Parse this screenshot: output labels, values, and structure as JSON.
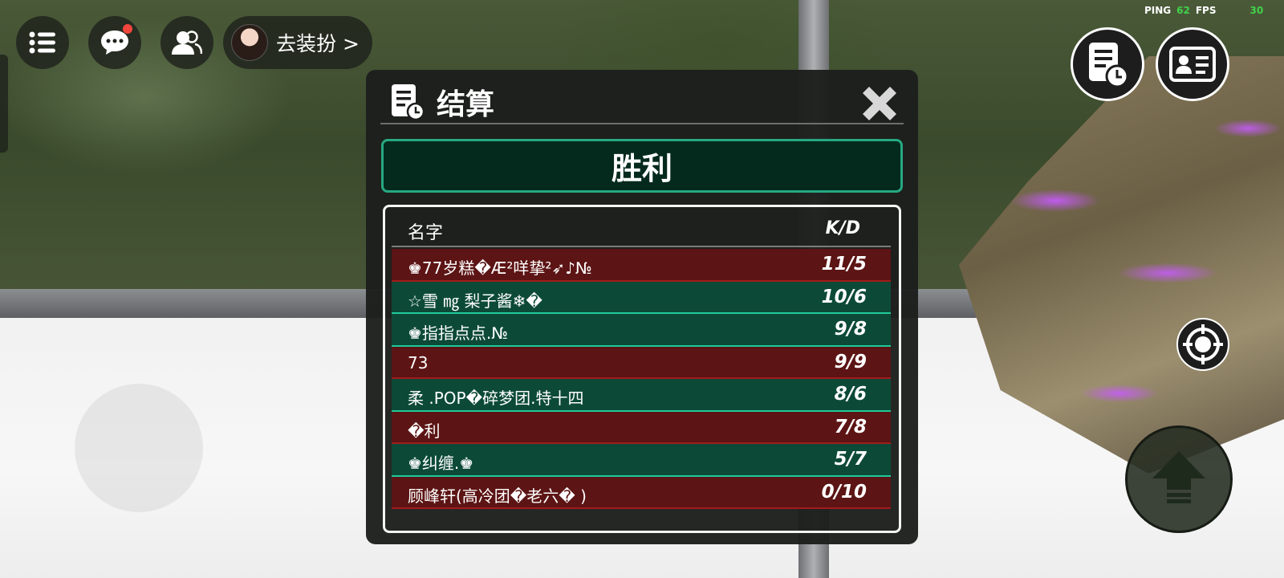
{
  "hud": {
    "dress_label": "去装扮 >",
    "ping_label": "PING",
    "ping_value": "62",
    "fps_label": "FPS",
    "fps_value": "30",
    "chat_has_notification": true
  },
  "dialog": {
    "title": "结算",
    "result": "胜利",
    "columns": {
      "name": "名字",
      "kd": "K/D"
    },
    "rows": [
      {
        "name": "♚77岁糕�Æ²咩挚²➶♪№",
        "kd": "11/5",
        "team": "red"
      },
      {
        "name": "☆雪 ㎎ 梨子酱❄�",
        "kd": "10/6",
        "team": "green"
      },
      {
        "name": "♚指指点点.№",
        "kd": "9/8",
        "team": "green"
      },
      {
        "name": "73",
        "kd": "9/9",
        "team": "red"
      },
      {
        "name": "柔 .POP�碎梦团.特十四",
        "kd": "8/6",
        "team": "green"
      },
      {
        "name": "�利",
        "kd": "7/8",
        "team": "red"
      },
      {
        "name": "♚纠缠.♚",
        "kd": "5/7",
        "team": "green"
      },
      {
        "name": "顾峰轩(高冷团�老六� )",
        "kd": "0/10",
        "team": "red"
      }
    ]
  },
  "colors": {
    "red_row": "#5c1414",
    "green_row": "#0c4a37",
    "banner_border": "#27a882",
    "ping_green": "#3fd34a",
    "badge_red": "#f2463c"
  }
}
